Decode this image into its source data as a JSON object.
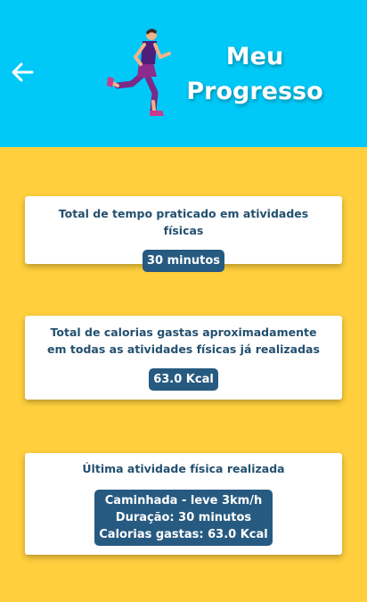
{
  "header": {
    "title_line1": "Meu",
    "title_line2": "Progresso",
    "back_icon": "arrow-left-icon",
    "illustration": "runner-illustration"
  },
  "cards": [
    {
      "label": "Total de tempo praticado em atividades físicas",
      "value": "30 minutos"
    },
    {
      "label": "Total de calorias gastas aproximadamente em todas as atividades físicas já realizadas",
      "value": "63.0 Kcal"
    },
    {
      "label": "Última atividade física realizada",
      "value_lines": [
        "Caminhada - leve 3km/h",
        "Duração: 30 minutos",
        "Calorias gastas: 63.0 Kcal"
      ]
    }
  ],
  "colors": {
    "header_bg": "#00C9F7",
    "page_bg": "#FFCF3D",
    "card_text": "#23506F",
    "pill_bg": "#275A80"
  }
}
